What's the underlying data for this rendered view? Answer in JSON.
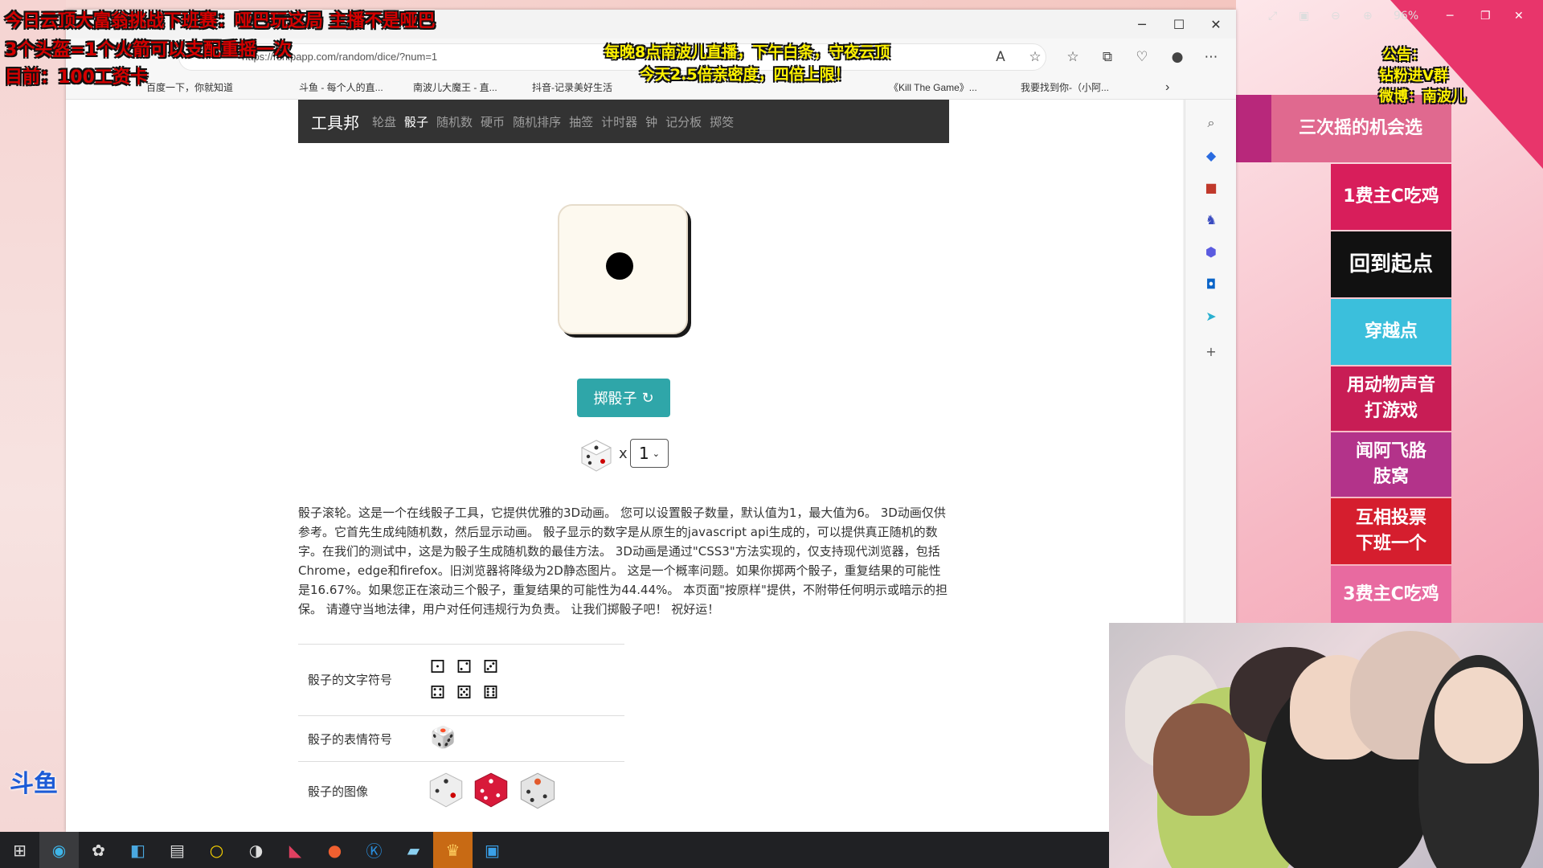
{
  "browser": {
    "url": "https://rshipapp.com/random/dice/?num=1",
    "zoom": "96%",
    "bookmarks": [
      "百度一下，你就知道",
      "斗鱼 - 每个人的直...",
      "南波儿大魔王 - 直...",
      "抖音-记录美好生活",
      "《Kill The Game》...",
      "我要找到你-（小阿..."
    ],
    "window_controls": {
      "minimize": "─",
      "maximize": "☐",
      "close": "✕"
    }
  },
  "site": {
    "brand": "工具邦",
    "nav": [
      {
        "label": "轮盘",
        "active": false
      },
      {
        "label": "骰子",
        "active": true
      },
      {
        "label": "随机数",
        "active": false
      },
      {
        "label": "硬币",
        "active": false
      },
      {
        "label": "随机排序",
        "active": false
      },
      {
        "label": "抽签",
        "active": false
      },
      {
        "label": "计时器",
        "active": false
      },
      {
        "label": "钟",
        "active": false
      },
      {
        "label": "记分板",
        "active": false
      },
      {
        "label": "掷筊",
        "active": false
      }
    ],
    "roll_button": "掷骰子",
    "roll_icon": "↻",
    "times": "x",
    "dice_count": "1",
    "description": "骰子滚轮。这是一个在线骰子工具，它提供优雅的3D动画。 您可以设置骰子数量，默认值为1，最大值为6。 3D动画仅供参考。它首先生成纯随机数，然后显示动画。 骰子显示的数字是从原生的javascript api生成的，可以提供真正随机的数字。在我们的测试中，这是为骰子生成随机数的最佳方法。 3D动画是通过\"CSS3\"方法实现的，仅支持现代浏览器，包括Chrome，edge和firefox。旧浏览器将降级为2D静态图片。 这是一个概率问题。如果你掷两个骰子，重复结果的可能性是16.67%。如果您正在滚动三个骰子，重复结果的可能性为44.44%。 本页面\"按原样\"提供，不附带任何明示或暗示的担保。 请遵守当地法律，用户对任何违规行为负责。 让我们掷骰子吧！ 祝好运！",
    "symbols": {
      "text_label": "骰子的文字符号",
      "text_glyphs": [
        "⚀",
        "⚁",
        "⚂",
        "⚃",
        "⚄",
        "⚅"
      ],
      "emoji_label": "骰子的表情符号",
      "emoji_glyph": "🎲",
      "image_label": "骰子的图像"
    }
  },
  "overlay": {
    "title_line1": "今日云顶大富翁挑战下班赛：哑巴玩这局 主播不是哑巴",
    "title_line2": "3个头盔=1个火箭可以支配重摇一次",
    "title_line3": "目前：100工资卡",
    "center_line1": "每晚8点南波儿直播，下午白条，守夜云顶",
    "center_line2": "今天2.5倍亲密度，四倍上限！",
    "notice_line1": "公告：",
    "notice_line2": "钻粉进V群",
    "notice_line3": "微博：南波儿",
    "douyu": "斗鱼"
  },
  "cards": [
    {
      "label": "三次摇的机会选",
      "color": "#e0698f"
    },
    {
      "label": "1费主C吃鸡",
      "color": "#d81e5b"
    },
    {
      "label": "回到起点",
      "color": "#111111"
    },
    {
      "label": "穿越点",
      "color": "#3bbfdc"
    },
    {
      "label": "用动物声音\n打游戏",
      "color": "#c81d55"
    },
    {
      "label": "闻阿飞胳\n肢窝",
      "color": "#b3338a"
    },
    {
      "label": "互相投票\n下班一个",
      "color": "#d51e2e"
    },
    {
      "label": "3费主C吃鸡",
      "color": "#e86aa0"
    }
  ],
  "colors": {
    "accent": "#2fa6a9",
    "nav_bg": "#333333",
    "overlay_red": "#d40000",
    "overlay_yellow": "#fff200"
  }
}
